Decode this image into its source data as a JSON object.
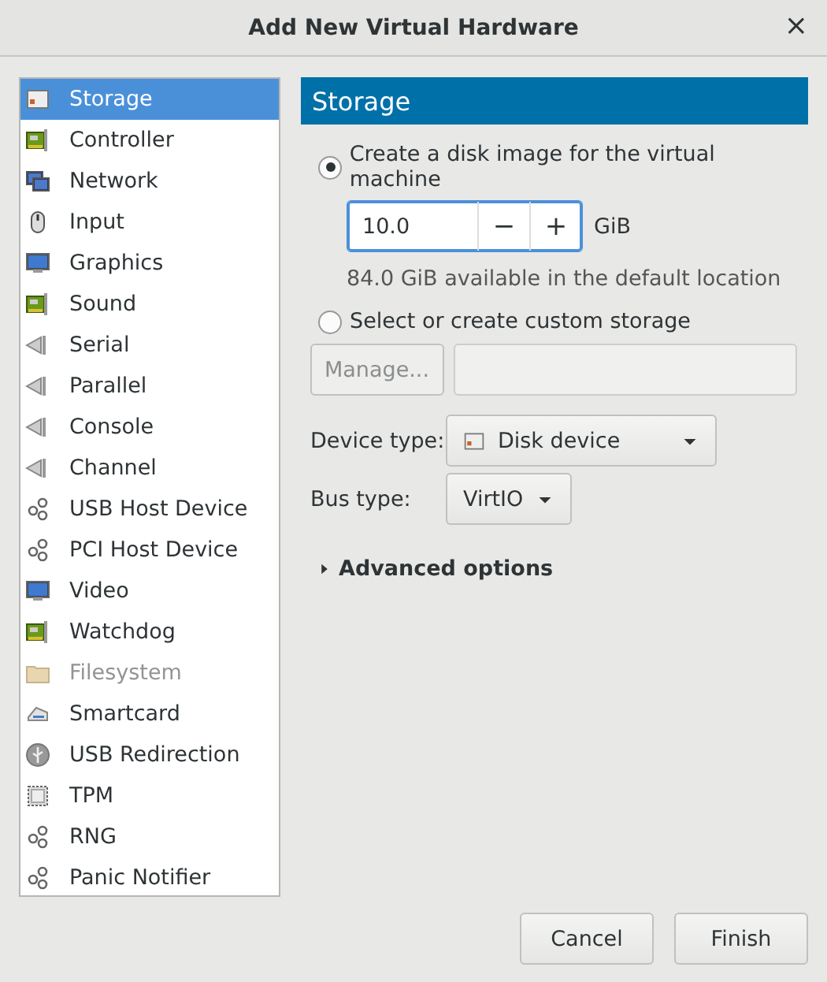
{
  "window": {
    "title": "Add New Virtual Hardware",
    "close": "×"
  },
  "sidebar": {
    "items": [
      {
        "label": "Storage",
        "kind": "disk",
        "selected": true,
        "disabled": false
      },
      {
        "label": "Controller",
        "kind": "card",
        "selected": false,
        "disabled": false
      },
      {
        "label": "Network",
        "kind": "network",
        "selected": false,
        "disabled": false
      },
      {
        "label": "Input",
        "kind": "mouse",
        "selected": false,
        "disabled": false
      },
      {
        "label": "Graphics",
        "kind": "monitor",
        "selected": false,
        "disabled": false
      },
      {
        "label": "Sound",
        "kind": "card",
        "selected": false,
        "disabled": false
      },
      {
        "label": "Serial",
        "kind": "plug",
        "selected": false,
        "disabled": false
      },
      {
        "label": "Parallel",
        "kind": "plug",
        "selected": false,
        "disabled": false
      },
      {
        "label": "Console",
        "kind": "plug",
        "selected": false,
        "disabled": false
      },
      {
        "label": "Channel",
        "kind": "plug",
        "selected": false,
        "disabled": false
      },
      {
        "label": "USB Host Device",
        "kind": "gears",
        "selected": false,
        "disabled": false
      },
      {
        "label": "PCI Host Device",
        "kind": "gears",
        "selected": false,
        "disabled": false
      },
      {
        "label": "Video",
        "kind": "monitor",
        "selected": false,
        "disabled": false
      },
      {
        "label": "Watchdog",
        "kind": "card",
        "selected": false,
        "disabled": false
      },
      {
        "label": "Filesystem",
        "kind": "folder",
        "selected": false,
        "disabled": true
      },
      {
        "label": "Smartcard",
        "kind": "reader",
        "selected": false,
        "disabled": false
      },
      {
        "label": "USB Redirection",
        "kind": "usb",
        "selected": false,
        "disabled": false
      },
      {
        "label": "TPM",
        "kind": "chip",
        "selected": false,
        "disabled": false
      },
      {
        "label": "RNG",
        "kind": "gears",
        "selected": false,
        "disabled": false
      },
      {
        "label": "Panic Notifier",
        "kind": "gears",
        "selected": false,
        "disabled": false
      }
    ]
  },
  "panel": {
    "title": "Storage",
    "options": [
      {
        "label": "Create a disk image for the virtual machine",
        "selected": true
      },
      {
        "label": "Select or create custom storage",
        "selected": false
      }
    ],
    "size": {
      "value": "10.0",
      "minus": "−",
      "plus": "+",
      "unit": "GiB"
    },
    "available": "84.0 GiB available in the default location",
    "manage_button": "Manage...",
    "device_type": {
      "label": "Device type:",
      "value": "Disk device"
    },
    "bus_type": {
      "label": "Bus type:",
      "value": "VirtIO"
    },
    "advanced": {
      "label": "Advanced options",
      "expanded": false
    }
  },
  "buttons": [
    "Cancel",
    "Finish"
  ]
}
